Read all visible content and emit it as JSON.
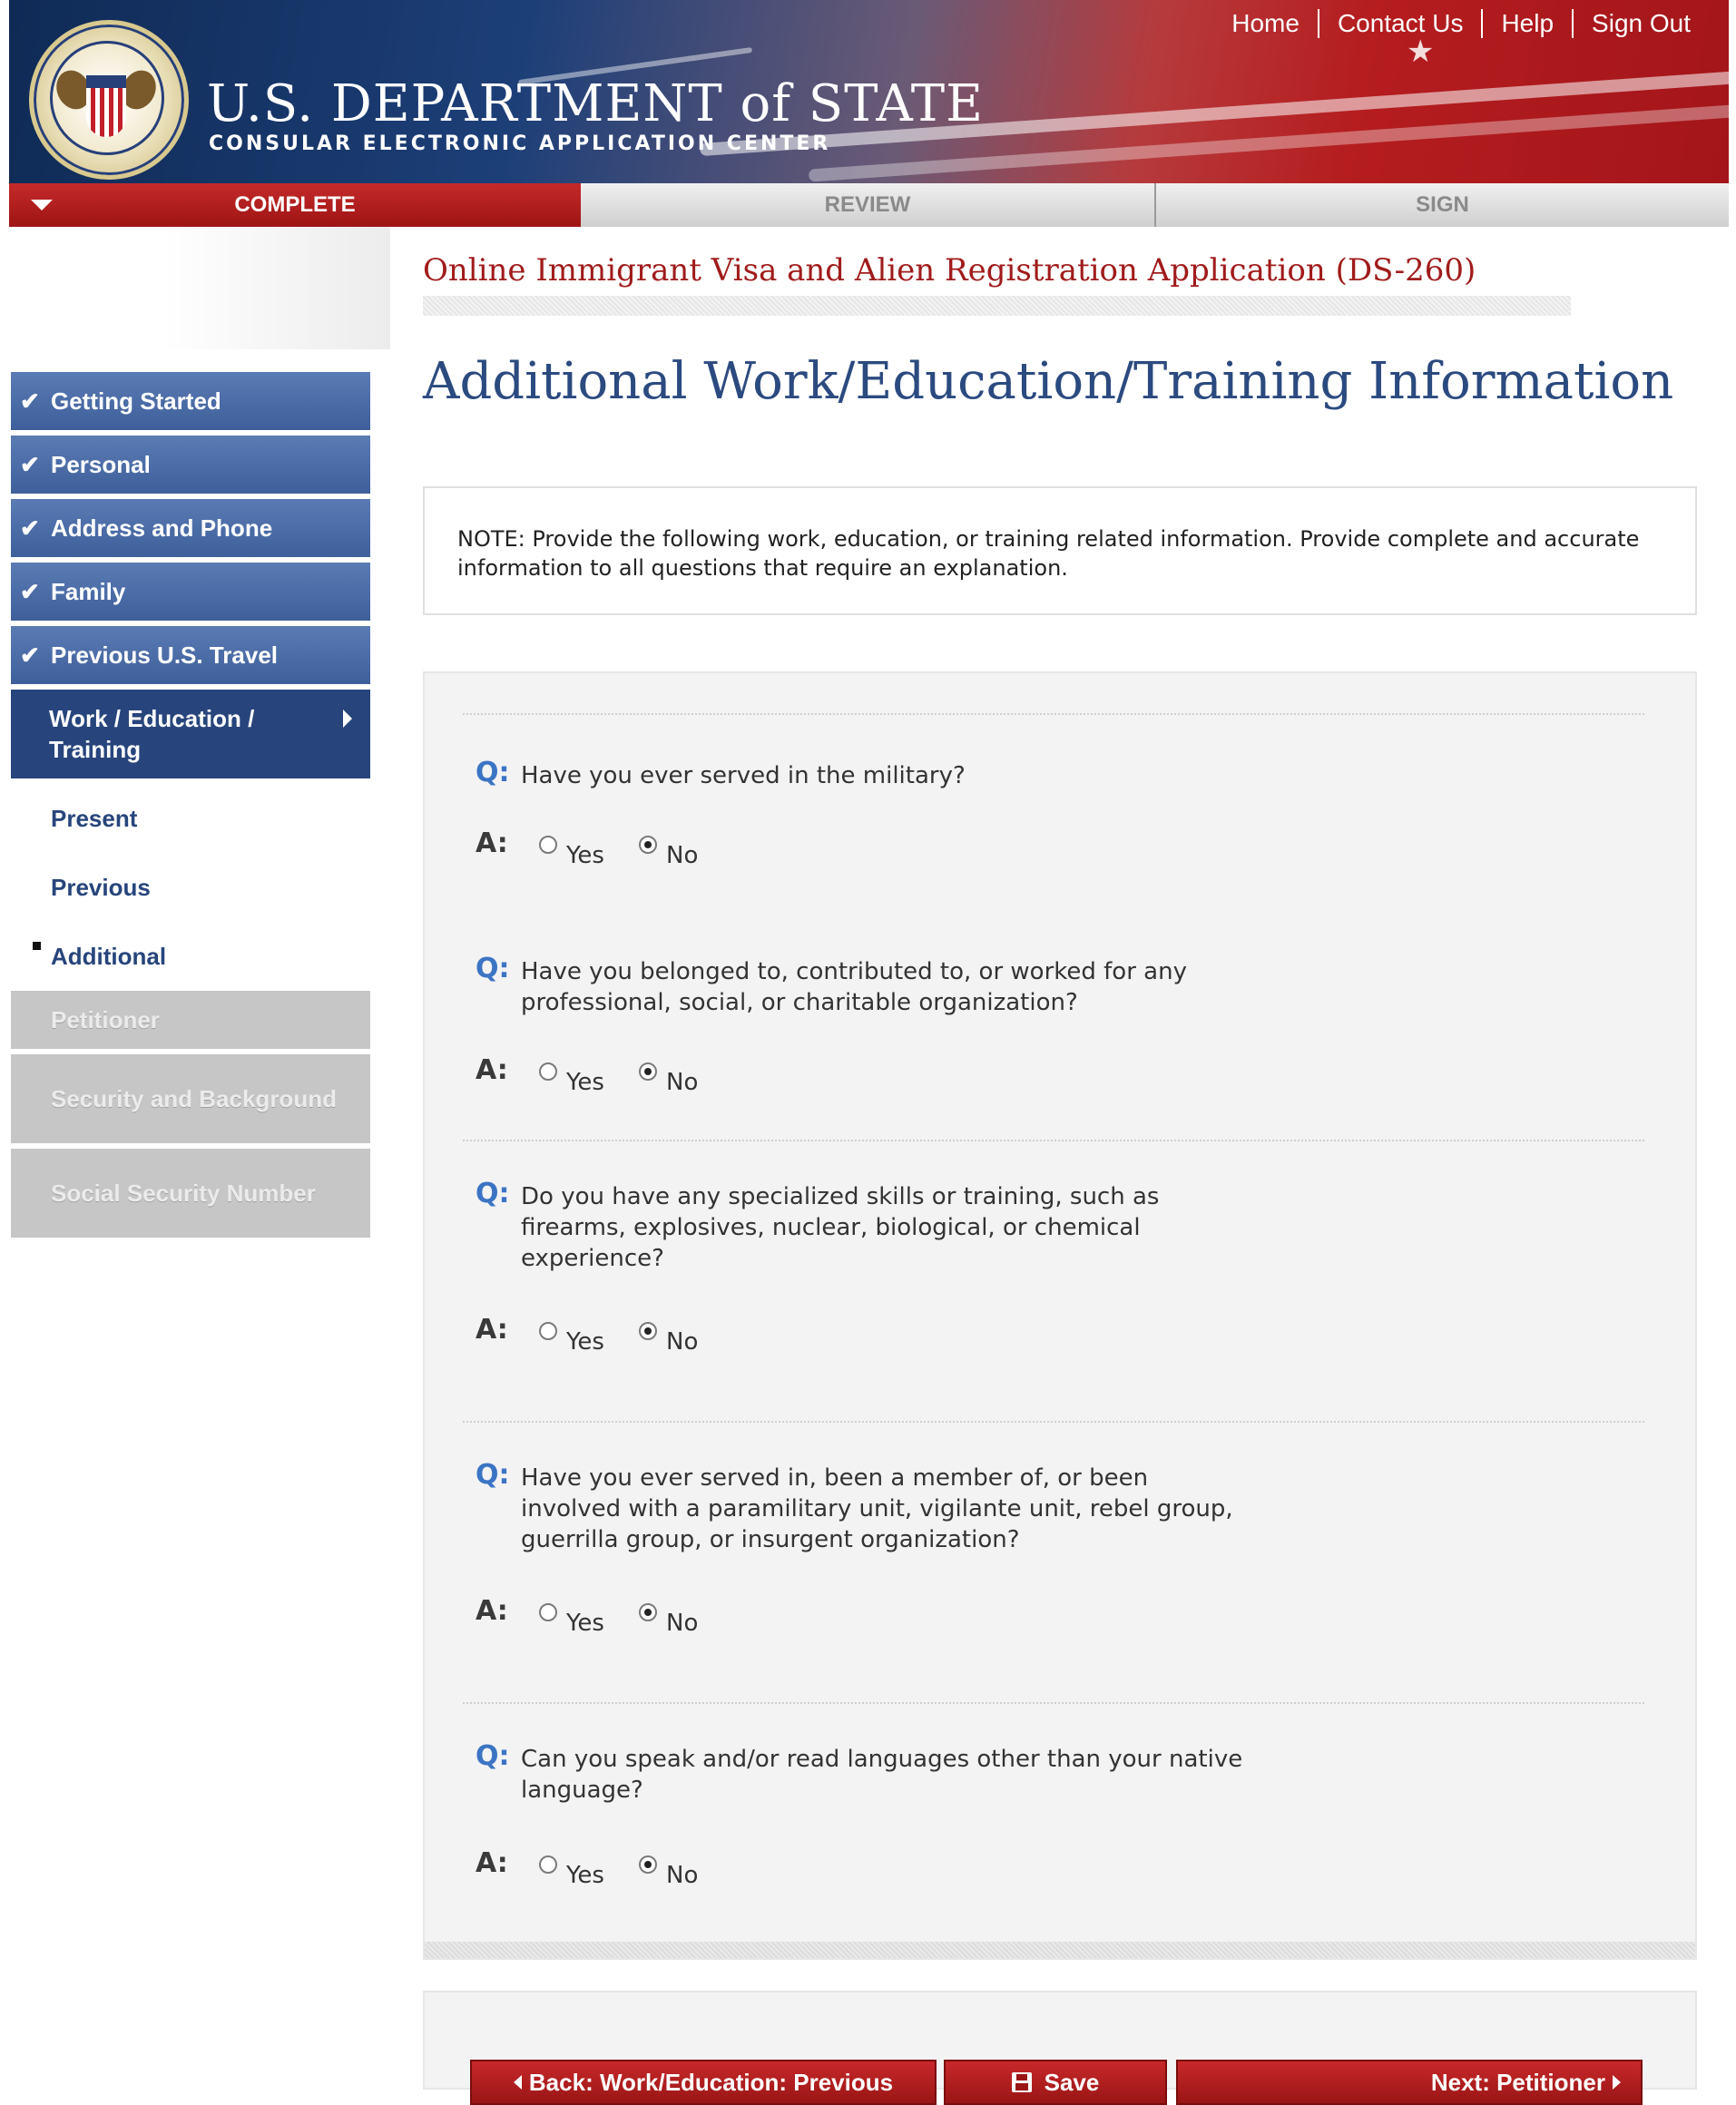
{
  "header": {
    "nav": [
      "Home",
      "Contact Us",
      "Help",
      "Sign Out"
    ],
    "brand_title": "U.S. DEPARTMENT of STATE",
    "brand_subtitle": "CONSULAR ELECTRONIC APPLICATION CENTER",
    "seal_icon": "department-of-state-seal"
  },
  "steps": {
    "complete": "COMPLETE",
    "review": "REVIEW",
    "sign": "SIGN"
  },
  "sidebar": {
    "done": [
      "Getting Started",
      "Personal",
      "Address and Phone",
      "Family",
      "Previous U.S. Travel"
    ],
    "current": "Work / Education / Training",
    "sub_items": [
      "Present",
      "Previous",
      "Additional"
    ],
    "active_sub": "Additional",
    "locked": [
      "Petitioner",
      "Security and Background",
      "Social Security Number"
    ]
  },
  "main": {
    "app_title": "Online Immigrant Visa and Alien Registration Application (DS-260)",
    "page_title": "Additional Work/Education/Training Information",
    "note": "NOTE: Provide the following work, education, or training related information. Provide complete and accurate information to all questions that require an explanation.",
    "q_label": "Q:",
    "a_label": "A:",
    "yes": "Yes",
    "no": "No",
    "questions": [
      {
        "text": "Have you ever served in the military?",
        "answer": "No"
      },
      {
        "text": "Have you belonged to, contributed to, or worked for any professional, social, or charitable organization?",
        "answer": "No"
      },
      {
        "text": "Do you have any specialized skills or training, such as firearms, explosives, nuclear, biological, or chemical experience?",
        "answer": "No"
      },
      {
        "text": "Have you ever served in, been a member of, or been involved with a paramilitary unit, vigilante unit, rebel group, guerrilla group, or insurgent organization?",
        "answer": "No"
      },
      {
        "text": "Can you speak and/or read languages other than your native language?",
        "answer": "No"
      }
    ]
  },
  "buttons": {
    "back": "Back: Work/Education: Previous",
    "save": "Save",
    "next": "Next: Petitioner"
  },
  "colors": {
    "brand_red": "#9e1414",
    "nav_blue": "#27457c",
    "title_red": "#a11b1b",
    "question_blue": "#3c74c4"
  }
}
